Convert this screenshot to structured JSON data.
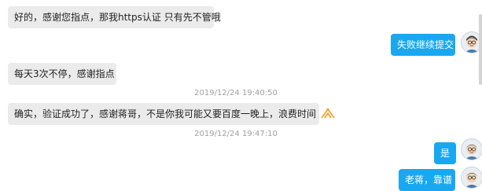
{
  "messages": {
    "m1": "好的，感谢您指点，那我https认证 只有先不管哦",
    "m2": "失败继续提交",
    "m3": "每天3次不停，感谢指点",
    "t1": "2019/12/24 19:40:50",
    "m4": "确实，验证成功了，感谢蒋哥，不是你我可能又要百度一晚上，浪费时间",
    "t2": "2019/12/24 19:47:10",
    "m5": "是",
    "m6": "老蒋，靠谱"
  },
  "icons": {
    "avatar": "user-avatar",
    "emoji": "bowing-emoji-icon"
  },
  "colors": {
    "incoming_bubble": "#ebebeb",
    "outgoing_bubble": "#19a8f0",
    "timestamp": "#a0a0a0"
  }
}
